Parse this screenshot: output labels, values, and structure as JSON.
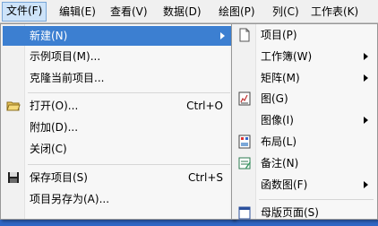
{
  "menubar": {
    "items": [
      {
        "label": "文件(F)"
      },
      {
        "label": "编辑(E)"
      },
      {
        "label": "查看(V)"
      },
      {
        "label": "数据(D)"
      },
      {
        "label": "绘图(P)"
      },
      {
        "label": "列(C)"
      },
      {
        "label": "工作表(K)"
      }
    ]
  },
  "file_menu": {
    "items": [
      {
        "label": "新建(N)",
        "shortcut": ""
      },
      {
        "label": "示例项目(M)...",
        "shortcut": ""
      },
      {
        "label": "克隆当前项目...",
        "shortcut": ""
      },
      {
        "label": "打开(O)...",
        "shortcut": "Ctrl+O"
      },
      {
        "label": "附加(D)...",
        "shortcut": ""
      },
      {
        "label": "关闭(C)",
        "shortcut": ""
      },
      {
        "label": "保存项目(S)",
        "shortcut": "Ctrl+S"
      },
      {
        "label": "项目另存为(A)...",
        "shortcut": ""
      }
    ]
  },
  "new_submenu": {
    "items": [
      {
        "label": "项目(P)"
      },
      {
        "label": "工作簿(W)"
      },
      {
        "label": "矩阵(M)"
      },
      {
        "label": "图(G)"
      },
      {
        "label": "图像(I)"
      },
      {
        "label": "布局(L)"
      },
      {
        "label": "备注(N)"
      },
      {
        "label": "函数图(F)"
      },
      {
        "label": "母版页面(S)"
      }
    ]
  },
  "colors": {
    "highlight": "#3c7fd1",
    "desktop": "#2f66c4"
  }
}
